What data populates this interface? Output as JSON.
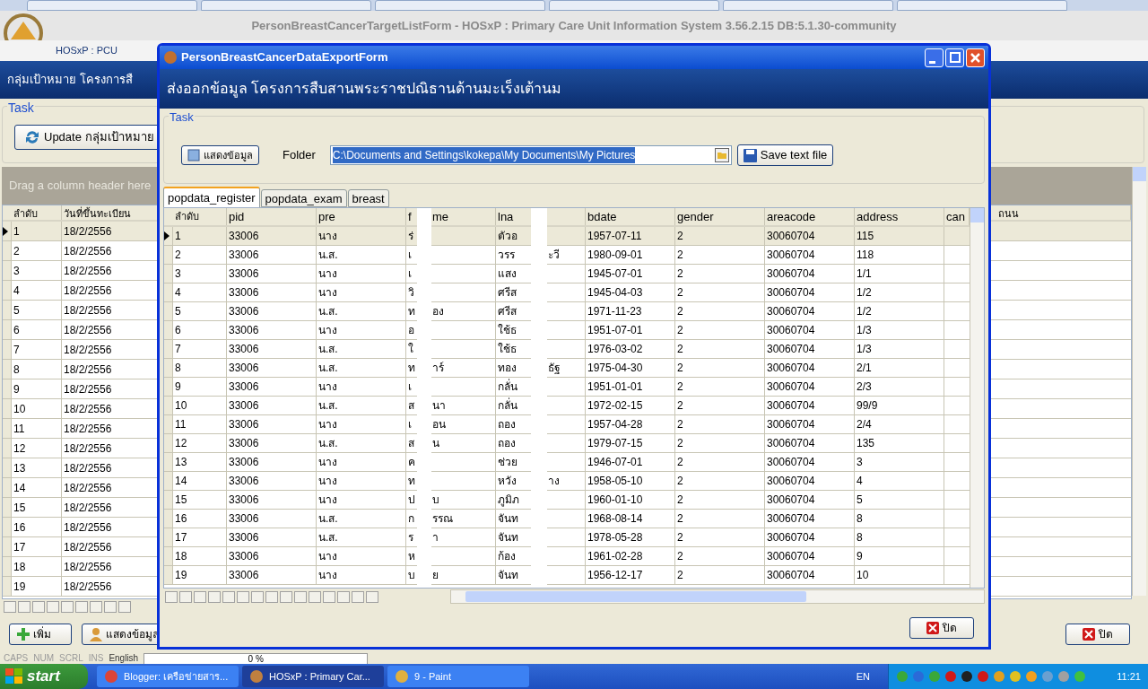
{
  "main_window": {
    "title": "PersonBreastCancerTargetListForm -  HOSxP : Primary Care Unit Information System 3.56.2.15 DB:5.1.30-community",
    "mdi_label": "HOSxP : PCU",
    "header": "กลุ่มเป้าหมาย โครงการสื",
    "task_label": "Task",
    "update_button": "Update กลุ่มเป้าหมาย",
    "group_hint": "Drag a column header here",
    "columns": [
      "ลำดับ",
      "วันที่ขึ้นทะเบียน",
      "ถนน"
    ],
    "rows": [
      {
        "no": "1",
        "date": "18/2/2556",
        "selected": true
      },
      {
        "no": "2",
        "date": "18/2/2556",
        "selected": false
      },
      {
        "no": "3",
        "date": "18/2/2556",
        "selected": false
      },
      {
        "no": "4",
        "date": "18/2/2556",
        "selected": false
      },
      {
        "no": "5",
        "date": "18/2/2556",
        "selected": false
      },
      {
        "no": "6",
        "date": "18/2/2556",
        "selected": false
      },
      {
        "no": "7",
        "date": "18/2/2556",
        "selected": false
      },
      {
        "no": "8",
        "date": "18/2/2556",
        "selected": false
      },
      {
        "no": "9",
        "date": "18/2/2556",
        "selected": false
      },
      {
        "no": "10",
        "date": "18/2/2556",
        "selected": false
      },
      {
        "no": "11",
        "date": "18/2/2556",
        "selected": false
      },
      {
        "no": "12",
        "date": "18/2/2556",
        "selected": false
      },
      {
        "no": "13",
        "date": "18/2/2556",
        "selected": false
      },
      {
        "no": "14",
        "date": "18/2/2556",
        "selected": false
      },
      {
        "no": "15",
        "date": "18/2/2556",
        "selected": false
      },
      {
        "no": "16",
        "date": "18/2/2556",
        "selected": false
      },
      {
        "no": "17",
        "date": "18/2/2556",
        "selected": false
      },
      {
        "no": "18",
        "date": "18/2/2556",
        "selected": false
      },
      {
        "no": "19",
        "date": "18/2/2556",
        "selected": false
      }
    ],
    "add_button": "เพิ่ม",
    "show_button": "แสดงข้อมูล",
    "close_button": "ปิด"
  },
  "dialog": {
    "title": "PersonBreastCancerDataExportForm",
    "header": "ส่งออกข้อมูล โครงการสืบสานพระราชปณิธานด้านมะเร็งเต้านม",
    "task_label": "Task",
    "show_button": "แสดงข้อมูล",
    "folder_label": "Folder",
    "folder": "C:\\Documents and Settings\\kokepa\\My Documents\\My Pictures",
    "save_button": "Save text file",
    "tabs": [
      {
        "label": "popdata_register",
        "selected": true
      },
      {
        "label": "popdata_exam",
        "selected": false
      },
      {
        "label": "breast",
        "selected": false
      }
    ],
    "columns": [
      "ลำดับ",
      "pid",
      "pre",
      "f",
      "me",
      "lna",
      "bdate",
      "gender",
      "areacode",
      "address",
      "can"
    ],
    "rows": [
      {
        "no": "1",
        "pid": "33006",
        "pre": "นาง",
        "fname": [
          "ร่"
        ],
        "lname": [
          "ตัวอ"
        ],
        "bdate": "1957-07-11",
        "gender": "2",
        "areacode": "30060704",
        "address": "115",
        "selected": true
      },
      {
        "no": "2",
        "pid": "33006",
        "pre": "น.ส.",
        "fname": [
          "เ"
        ],
        "lname": [
          "วรร",
          "ะวี"
        ],
        "bdate": "1980-09-01",
        "gender": "2",
        "areacode": "30060704",
        "address": "118",
        "selected": false
      },
      {
        "no": "3",
        "pid": "33006",
        "pre": "นาง",
        "fname": [
          "เ"
        ],
        "lname": [
          "แสง"
        ],
        "bdate": "1945-07-01",
        "gender": "2",
        "areacode": "30060704",
        "address": "1/1",
        "selected": false
      },
      {
        "no": "4",
        "pid": "33006",
        "pre": "นาง",
        "fname": [
          "วิ"
        ],
        "lname": [
          "ศรีส"
        ],
        "bdate": "1945-04-03",
        "gender": "2",
        "areacode": "30060704",
        "address": "1/2",
        "selected": false
      },
      {
        "no": "5",
        "pid": "33006",
        "pre": "น.ส.",
        "fname": [
          "ท",
          "อง"
        ],
        "lname": [
          "ศรีส"
        ],
        "bdate": "1971-11-23",
        "gender": "2",
        "areacode": "30060704",
        "address": "1/2",
        "selected": false
      },
      {
        "no": "6",
        "pid": "33006",
        "pre": "นาง",
        "fname": [
          "อ"
        ],
        "lname": [
          "ใช้ธ"
        ],
        "bdate": "1951-07-01",
        "gender": "2",
        "areacode": "30060704",
        "address": "1/3",
        "selected": false
      },
      {
        "no": "7",
        "pid": "33006",
        "pre": "น.ส.",
        "fname": [
          "ใ"
        ],
        "lname": [
          "ใช้ธ"
        ],
        "bdate": "1976-03-02",
        "gender": "2",
        "areacode": "30060704",
        "address": "1/3",
        "selected": false
      },
      {
        "no": "8",
        "pid": "33006",
        "pre": "น.ส.",
        "fname": [
          "ท",
          "าร์"
        ],
        "lname": [
          "ทอง",
          "ธัฐ"
        ],
        "bdate": "1975-04-30",
        "gender": "2",
        "areacode": "30060704",
        "address": "2/1",
        "selected": false
      },
      {
        "no": "9",
        "pid": "33006",
        "pre": "นาง",
        "fname": [
          "เ"
        ],
        "lname": [
          "กลั่น"
        ],
        "bdate": "1951-01-01",
        "gender": "2",
        "areacode": "30060704",
        "address": "2/3",
        "selected": false
      },
      {
        "no": "10",
        "pid": "33006",
        "pre": "น.ส.",
        "fname": [
          "ส",
          "นา"
        ],
        "lname": [
          "กลั่น"
        ],
        "bdate": "1972-02-15",
        "gender": "2",
        "areacode": "30060704",
        "address": "99/9",
        "selected": false
      },
      {
        "no": "11",
        "pid": "33006",
        "pre": "นาง",
        "fname": [
          "เ",
          "อน"
        ],
        "lname": [
          "ถอง"
        ],
        "bdate": "1957-04-28",
        "gender": "2",
        "areacode": "30060704",
        "address": "2/4",
        "selected": false
      },
      {
        "no": "12",
        "pid": "33006",
        "pre": "น.ส.",
        "fname": [
          "ส",
          "น"
        ],
        "lname": [
          "ถอง"
        ],
        "bdate": "1979-07-15",
        "gender": "2",
        "areacode": "30060704",
        "address": "135",
        "selected": false
      },
      {
        "no": "13",
        "pid": "33006",
        "pre": "นาง",
        "fname": [
          "ค"
        ],
        "lname": [
          "ช่วย"
        ],
        "bdate": "1946-07-01",
        "gender": "2",
        "areacode": "30060704",
        "address": "3",
        "selected": false
      },
      {
        "no": "14",
        "pid": "33006",
        "pre": "นาง",
        "fname": [
          "ท"
        ],
        "lname": [
          "หวัง",
          "าง"
        ],
        "bdate": "1958-05-10",
        "gender": "2",
        "areacode": "30060704",
        "address": "4",
        "selected": false
      },
      {
        "no": "15",
        "pid": "33006",
        "pre": "นาง",
        "fname": [
          "ป",
          "บ"
        ],
        "lname": [
          "ภูมิภ"
        ],
        "bdate": "1960-01-10",
        "gender": "2",
        "areacode": "30060704",
        "address": "5",
        "selected": false
      },
      {
        "no": "16",
        "pid": "33006",
        "pre": "น.ส.",
        "fname": [
          "ก",
          "รรณ"
        ],
        "lname": [
          "จันท"
        ],
        "bdate": "1968-08-14",
        "gender": "2",
        "areacode": "30060704",
        "address": "8",
        "selected": false
      },
      {
        "no": "17",
        "pid": "33006",
        "pre": "น.ส.",
        "fname": [
          "ร",
          "า"
        ],
        "lname": [
          "จันท"
        ],
        "bdate": "1978-05-28",
        "gender": "2",
        "areacode": "30060704",
        "address": "8",
        "selected": false
      },
      {
        "no": "18",
        "pid": "33006",
        "pre": "นาง",
        "fname": [
          "ห"
        ],
        "lname": [
          "ก้อง"
        ],
        "bdate": "1961-02-28",
        "gender": "2",
        "areacode": "30060704",
        "address": "9",
        "selected": false
      },
      {
        "no": "19",
        "pid": "33006",
        "pre": "นาง",
        "fname": [
          "บ",
          "ย"
        ],
        "lname": [
          "จันท"
        ],
        "bdate": "1956-12-17",
        "gender": "2",
        "areacode": "30060704",
        "address": "10",
        "selected": false
      }
    ],
    "close_button": "ปิด"
  },
  "status_bar": {
    "indicators": [
      "CAPS",
      "NUM",
      "SCRL",
      "INS",
      "English"
    ],
    "progress": {
      "text": "0 %",
      "level": 0
    }
  },
  "taskbar": {
    "start": "start",
    "items": [
      {
        "label": "Blogger: เครือข่ายสาร...",
        "selected": false
      },
      {
        "label": "HOSxP : Primary Car...",
        "selected": true
      },
      {
        "label": "9 - Paint",
        "selected": false
      }
    ],
    "language": "EN",
    "clock": "11:21"
  }
}
